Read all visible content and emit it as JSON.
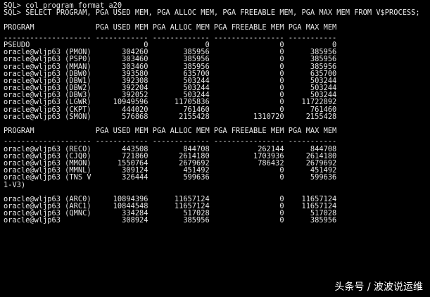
{
  "terminal": {
    "commands": [
      "SQL> col program format a20",
      "SQL> SELECT PROGRAM, PGA_USED_MEM, PGA_ALLOC_MEM, PGA_FREEABLE_MEM, PGA_MAX_MEM FROM V$PROCESS;"
    ],
    "header": "PROGRAM              PGA_USED_MEM PGA_ALLOC_MEM PGA_FREEABLE_MEM PGA_MAX_MEM",
    "separator": "-------------------- ------------ ------------- ---------------- -----------",
    "block1": [
      "PSEUDO                          0             0                0           0",
      "oracle@wljp63 (PMON)       304260        385956                0      385956",
      "oracle@wljp63 (PSP0)       303460        385956                0      385956",
      "oracle@wljp63 (MMAN)       303460        385956                0      385956",
      "oracle@wljp63 (DBW0)       393580        635700                0      635700",
      "oracle@wljp63 (DBW1)       392308        503244                0      503244",
      "oracle@wljp63 (DBW2)       392204        503244                0      503244",
      "oracle@wljp63 (DBW3)       392052        503244                0      503244",
      "oracle@wljp63 (LGWR)     10949596      11705836                0    11722892",
      "oracle@wljp63 (CKPT)       444020        761460                0      761460",
      "oracle@wljp63 (SMON)       576868       2155428          1310720     2155428"
    ],
    "block2": [
      "oracle@wljp63 (RECO)       443508        844708           262144      844708",
      "oracle@wljp63 (CJQ0)       721860       2614180          1703936     2614180",
      "oracle@wljp63 (MMON)      1550764       2679692           786432     2679692",
      "oracle@wljp63 (MMNL)       309124        451492                0      451492",
      "oracle@wljp63 (TNS V       326444        599636                0      599636",
      "1-V3)"
    ],
    "block3": [
      "oracle@wljp63 (ARC0)     10894396      11657124                0    11657124",
      "oracle@wljp63 (ARC1)     10844548      11657124                0    11657124",
      "oracle@wljp63 (QMNC)       334284        517028                0      517028",
      "oracle@wljp63              308924        385956                0      385956"
    ]
  },
  "watermark": "头条号 / 波波说运维"
}
